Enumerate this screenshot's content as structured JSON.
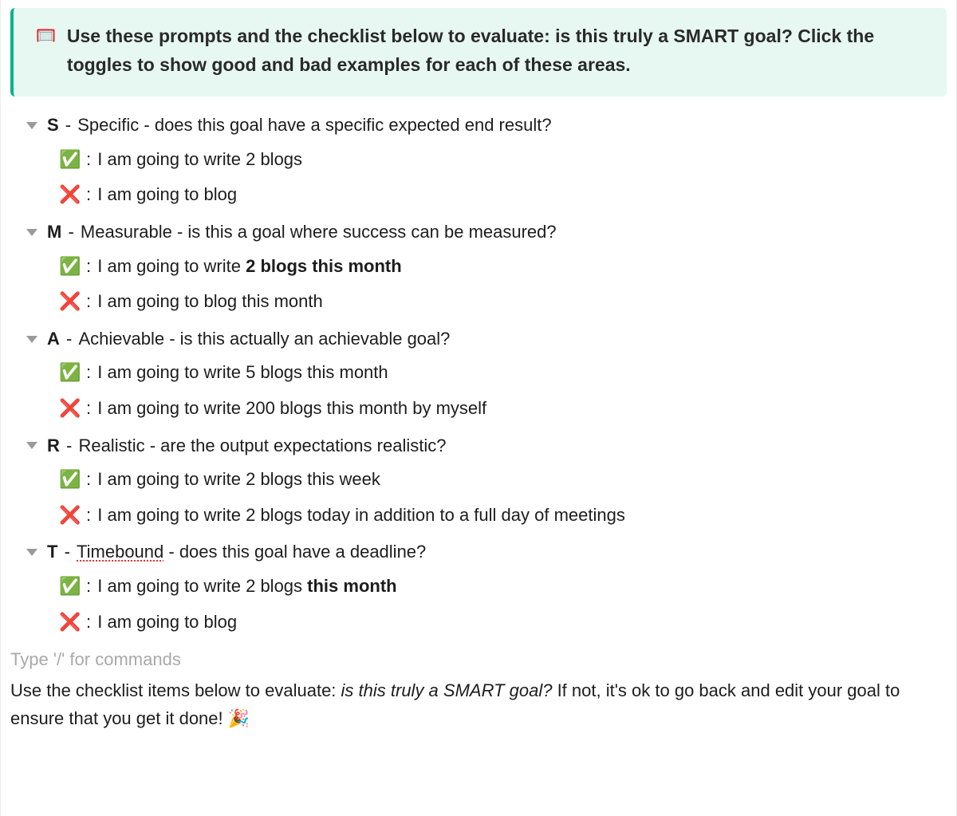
{
  "callout": {
    "icon": "🥅",
    "text": "Use these prompts and the checklist below to evaluate: is this truly a SMART goal? Click the toggles to show good and bad examples for each of these areas."
  },
  "items": [
    {
      "letter": "S",
      "title": "Specific - does this goal have a specific expected end result?",
      "good_prefix": "I am going to write 2 blogs",
      "good_bold": "",
      "bad": "I am going to blog",
      "spellcheck_title": false
    },
    {
      "letter": "M",
      "title": "Measurable - is this a goal where success can be measured?",
      "good_prefix": "I am going to write ",
      "good_bold": "2 blogs this month",
      "bad": "I am going to blog this month",
      "spellcheck_title": false
    },
    {
      "letter": "A",
      "title": "Achievable - is this actually an achievable goal?",
      "good_prefix": "I am going to write 5 blogs this month",
      "good_bold": "",
      "bad": "I am going to write 200 blogs this month by myself",
      "spellcheck_title": false
    },
    {
      "letter": "R",
      "title": "Realistic - are the output expectations realistic?",
      "good_prefix": "I am going to write 2 blogs this week",
      "good_bold": "",
      "bad": "I am going to write 2 blogs today in addition to a full day of meetings",
      "spellcheck_title": false
    },
    {
      "letter": "T",
      "title_word": "Timebound",
      "title_rest": " - does this goal have a deadline?",
      "good_prefix": "I am going to write 2 blogs ",
      "good_bold": "this month",
      "bad": "I am going to blog",
      "spellcheck_title": true
    }
  ],
  "placeholder": "Type '/' for commands",
  "footer": {
    "before": "Use the checklist items below to evaluate: ",
    "italic": "is this truly a SMART goal?",
    "after": " If not, it's ok to go back and edit your goal to ensure that you get it done! 🎉"
  },
  "icons": {
    "good": "✅",
    "bad": "❌"
  }
}
